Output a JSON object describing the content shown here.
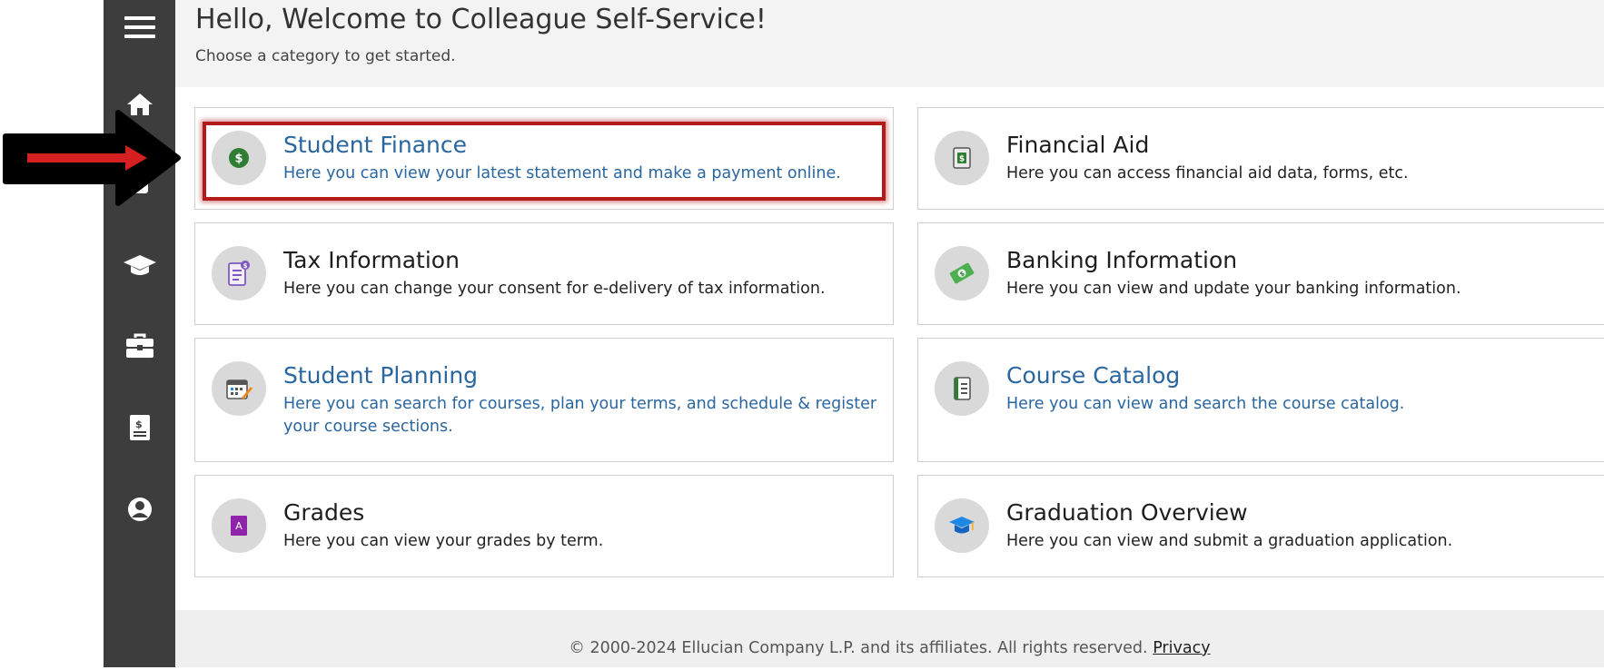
{
  "header": {
    "title": "Hello, Welcome to Colleague Self-Service!",
    "subtitle": "Choose a category to get started."
  },
  "sidebar": {
    "items": [
      {
        "icon": "menu-icon"
      },
      {
        "icon": "home-icon"
      },
      {
        "icon": "graduation-cap-icon"
      },
      {
        "icon": "briefcase-icon"
      },
      {
        "icon": "ledger-icon"
      },
      {
        "icon": "user-circle-icon"
      }
    ]
  },
  "cards": [
    {
      "title": "Student Finance",
      "description": "Here you can view your latest statement and make a payment online.",
      "icon": "dollar-coin-icon",
      "style": "link",
      "highlighted": true
    },
    {
      "title": "Financial Aid",
      "description": "Here you can access financial aid data, forms, etc.",
      "icon": "money-document-icon",
      "style": "plain"
    },
    {
      "title": "Tax Information",
      "description": "Here you can change your consent for e-delivery of tax information.",
      "icon": "tax-form-icon",
      "style": "plain"
    },
    {
      "title": "Banking Information",
      "description": "Here you can view and update your banking information.",
      "icon": "cash-icon",
      "style": "plain"
    },
    {
      "title": "Student Planning",
      "description": "Here you can search for courses, plan your terms, and schedule & register your course sections.",
      "icon": "calendar-pencil-icon",
      "style": "link"
    },
    {
      "title": "Course Catalog",
      "description": "Here you can view and search the course catalog.",
      "icon": "notebook-icon",
      "style": "link"
    },
    {
      "title": "Grades",
      "description": "Here you can view your grades by term.",
      "icon": "grade-report-icon",
      "style": "plain"
    },
    {
      "title": "Graduation Overview",
      "description": "Here you can view and submit a graduation application.",
      "icon": "graduation-cap-icon",
      "style": "plain"
    }
  ],
  "footer": {
    "copyright": "© 2000-2024 Ellucian Company L.P. and its affiliates. All rights reserved.",
    "privacy_label": "Privacy"
  },
  "colors": {
    "sidebar": "#3d3d3d",
    "link_text": "#2a669f",
    "highlight_border": "#b51a1a",
    "arrow_fill": "#d42020"
  }
}
